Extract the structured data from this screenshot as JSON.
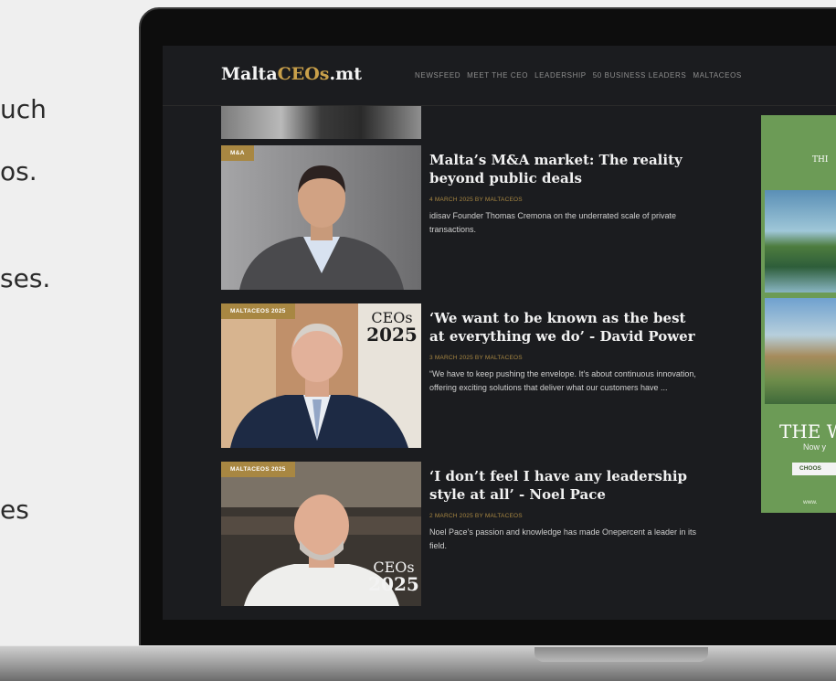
{
  "page_fragments": [
    "uch",
    "os.",
    "ses.",
    "es"
  ],
  "site": {
    "logo_left": "Malta",
    "logo_accent": "CEOs",
    "logo_right": ".mt",
    "nav": [
      "NEWSFEED",
      "MEET THE CEO",
      "LEADERSHIP",
      "50 BUSINESS LEADERS",
      "MALTACEOS"
    ]
  },
  "articles": [
    {
      "tag": "M&A",
      "title": "Malta’s M&A market: The reality beyond public deals",
      "meta": "4 MARCH 2025   BY MALTACEOS",
      "excerpt": "idisav Founder Thomas Cremona on the underrated scale of private transactions."
    },
    {
      "tag": "MALTACEOS 2025",
      "title": "‘We want to be known as the best at everything we do’ - David Power",
      "meta": "3 MARCH 2025   BY MALTACEOS",
      "excerpt": "“We have to keep pushing the envelope. It’s about continuous innovation, offering exciting solutions that deliver what our customers have ..."
    },
    {
      "tag": "MALTACEOS 2025",
      "title": "‘I don’t feel I have any leadership style at all’ - Noel Pace",
      "meta": "2 MARCH 2025   BY MALTACEOS",
      "excerpt": "Noel Pace’s passion and knowledge has made Onepercent a leader in its field."
    }
  ],
  "badge": {
    "line1": "CEOs",
    "line2": "2025"
  },
  "ad": {
    "small": "THI",
    "big": "THE W",
    "sub": "Now y",
    "btn": "CHOOS",
    "url": "www."
  }
}
